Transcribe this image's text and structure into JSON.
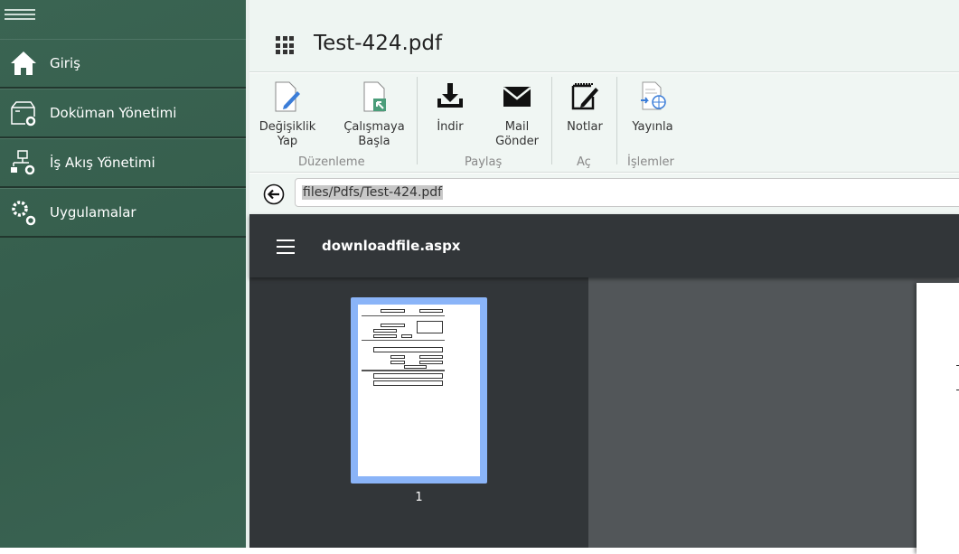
{
  "sidebar": {
    "items": [
      {
        "label": "Giriş",
        "icon": "home-icon"
      },
      {
        "label": "Doküman Yönetimi",
        "icon": "document-box-gear-icon"
      },
      {
        "label": "İş Akış Yönetimi",
        "icon": "workflow-gear-icon"
      },
      {
        "label": "Uygulamalar",
        "icon": "gears-icon"
      }
    ]
  },
  "header": {
    "title": "Test-424.pdf"
  },
  "ribbon": {
    "groups": [
      {
        "label": "Düzenleme",
        "buttons": [
          {
            "label1": "Değişiklik",
            "label2": "Yap"
          },
          {
            "label1": "Çalışmaya",
            "label2": "Başla"
          }
        ]
      },
      {
        "label": "Paylaş",
        "buttons": [
          {
            "label1": "İndir"
          },
          {
            "label1": "Mail",
            "label2": "Gönder"
          }
        ]
      },
      {
        "label": "Aç",
        "buttons": [
          {
            "label1": "Notlar"
          }
        ]
      },
      {
        "label": "İşlemler",
        "buttons": [
          {
            "label1": "Yayınla"
          }
        ]
      }
    ]
  },
  "address": {
    "value": "files/Pdfs/Test-424.pdf"
  },
  "viewer": {
    "filename": "downloadfile.aspx",
    "page_number": "1"
  },
  "colors": {
    "sidebar": "#365e4e",
    "thumb_selected": "#8ab4f8",
    "viewer_bar": "#323639"
  }
}
